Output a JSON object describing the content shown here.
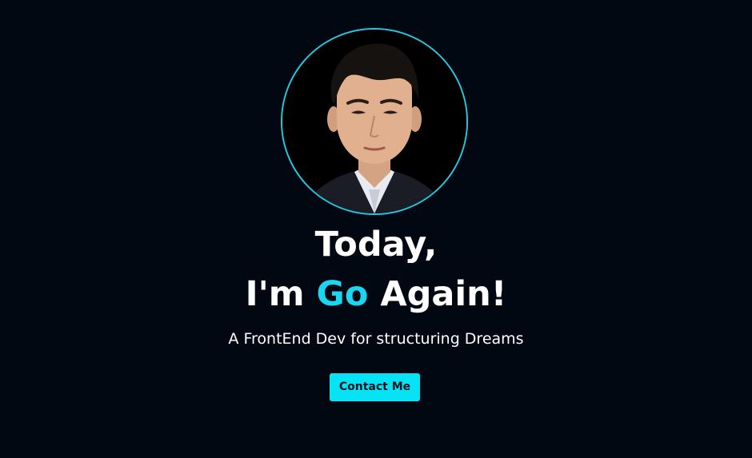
{
  "hero": {
    "avatar_alt": "profile photo",
    "headline_line1": "Today,",
    "headline_prefix": "I'm ",
    "headline_highlight": "Go",
    "headline_suffix": " Again!",
    "tagline": "A FrontEnd Dev for structuring Dreams",
    "contact_label": "Contact Me"
  },
  "colors": {
    "background": "#020812",
    "accent": "#1ad7ef",
    "button": "#05e3f5",
    "ring": "#22c9e0"
  }
}
